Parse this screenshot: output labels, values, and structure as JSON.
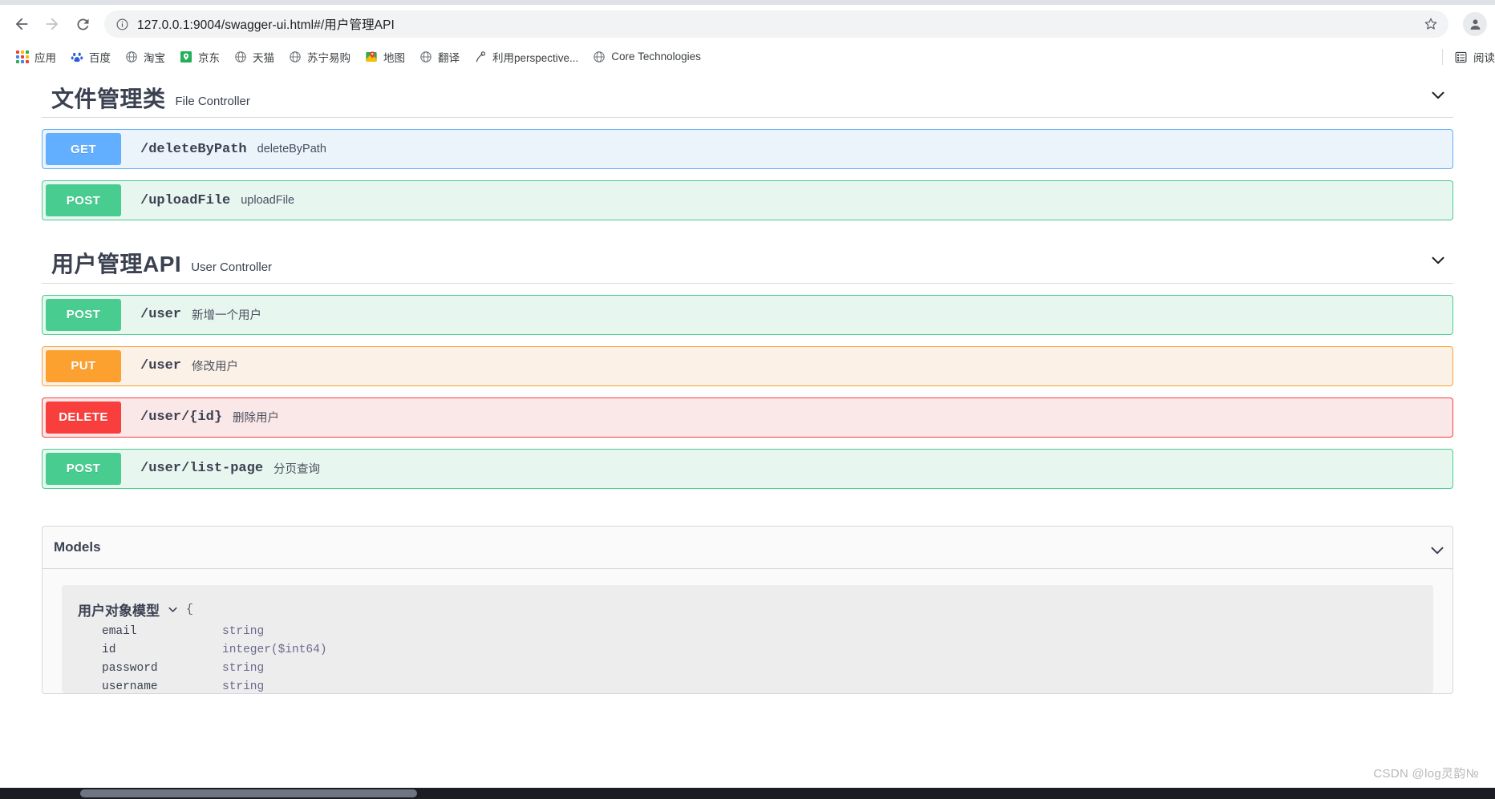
{
  "browser": {
    "nav": {
      "back_label": "Back",
      "forward_label": "Forward",
      "reload_label": "Reload"
    },
    "omnibox": {
      "url": "127.0.0.1:9004/swagger-ui.html#/用户管理API",
      "placeholder": "搜索或输入网址",
      "info_icon": "site-info-icon",
      "star_icon": "bookmark-star-icon"
    },
    "profile": {
      "avatar_icon": "profile-avatar-icon"
    },
    "bookmarks": [
      {
        "label": "应用",
        "icon": "apps-grid-icon"
      },
      {
        "label": "百度",
        "icon": "baidu-icon"
      },
      {
        "label": "淘宝",
        "icon": "globe-icon"
      },
      {
        "label": "京东",
        "icon": "jd-icon"
      },
      {
        "label": "天猫",
        "icon": "globe-icon"
      },
      {
        "label": "苏宁易购",
        "icon": "globe-icon"
      },
      {
        "label": "地图",
        "icon": "maps-pin-icon"
      },
      {
        "label": "翻译",
        "icon": "globe-icon"
      },
      {
        "label": "利用perspective...",
        "icon": "bookmark-page-icon"
      },
      {
        "label": "Core Technologies",
        "icon": "globe-icon"
      }
    ],
    "bookmarks_overflow": {
      "label": "阅读",
      "icon": "reading-list-icon"
    }
  },
  "swagger": {
    "sections": [
      {
        "title": "文件管理类",
        "subtitle": "File Controller",
        "collapse_icon": "chevron-down-icon",
        "operations": [
          {
            "method": "GET",
            "method_key": "get",
            "path": "/deleteByPath",
            "summary": "deleteByPath"
          },
          {
            "method": "POST",
            "method_key": "post",
            "path": "/uploadFile",
            "summary": "uploadFile"
          }
        ]
      },
      {
        "title": "用户管理API",
        "subtitle": "User Controller",
        "collapse_icon": "chevron-down-icon",
        "operations": [
          {
            "method": "POST",
            "method_key": "post",
            "path": "/user",
            "summary": "新增一个用户"
          },
          {
            "method": "PUT",
            "method_key": "put",
            "path": "/user",
            "summary": "修改用户"
          },
          {
            "method": "DELETE",
            "method_key": "delete",
            "path": "/user/{id}",
            "summary": "删除用户"
          },
          {
            "method": "POST",
            "method_key": "post",
            "path": "/user/list-page",
            "summary": "分页查询"
          }
        ]
      }
    ],
    "models": {
      "title": "Models",
      "collapse_icon": "chevron-down-icon",
      "items": [
        {
          "name": "用户对象模型",
          "toggle_icon": "chevron-down-icon",
          "open_brace": "{",
          "properties": [
            {
              "name": "email",
              "type": "string"
            },
            {
              "name": "id",
              "type": "integer($int64)"
            },
            {
              "name": "password",
              "type": "string"
            },
            {
              "name": "username",
              "type": "string"
            }
          ]
        }
      ]
    }
  },
  "watermark": {
    "text": "CSDN @log灵韵№"
  },
  "colors": {
    "get": "#61affe",
    "post": "#49cc90",
    "put": "#fca130",
    "delete": "#f93e3e"
  }
}
